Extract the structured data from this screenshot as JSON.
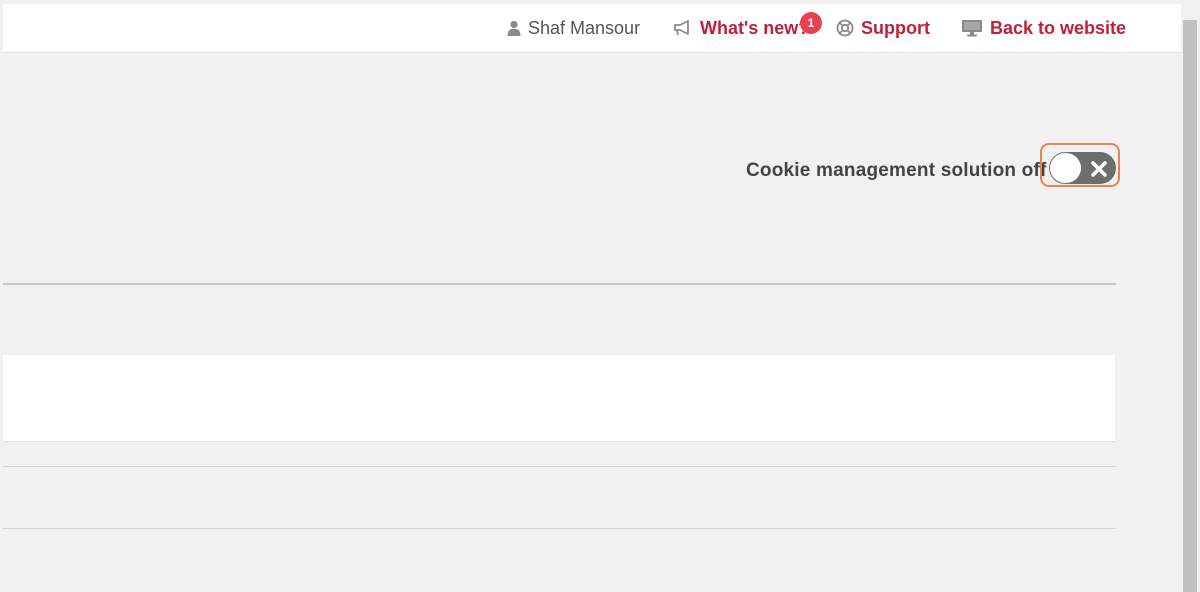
{
  "header": {
    "user_name": "Shaf Mansour",
    "whats_new_label": "What's new?",
    "whats_new_badge": "1",
    "support_label": "Support",
    "back_label": "Back to website"
  },
  "cookie": {
    "label": "Cookie management solution off",
    "enabled": false
  },
  "colors": {
    "link": "#c0203a",
    "badge": "#e6434f",
    "toggle_off": "#6d6d6d",
    "focus_ring": "#ee7f4e"
  },
  "icons": {
    "user": "user-icon",
    "whats_new": "megaphone-icon",
    "support": "lifebuoy-icon",
    "back": "monitor-icon",
    "toggle_state": "close-icon"
  }
}
